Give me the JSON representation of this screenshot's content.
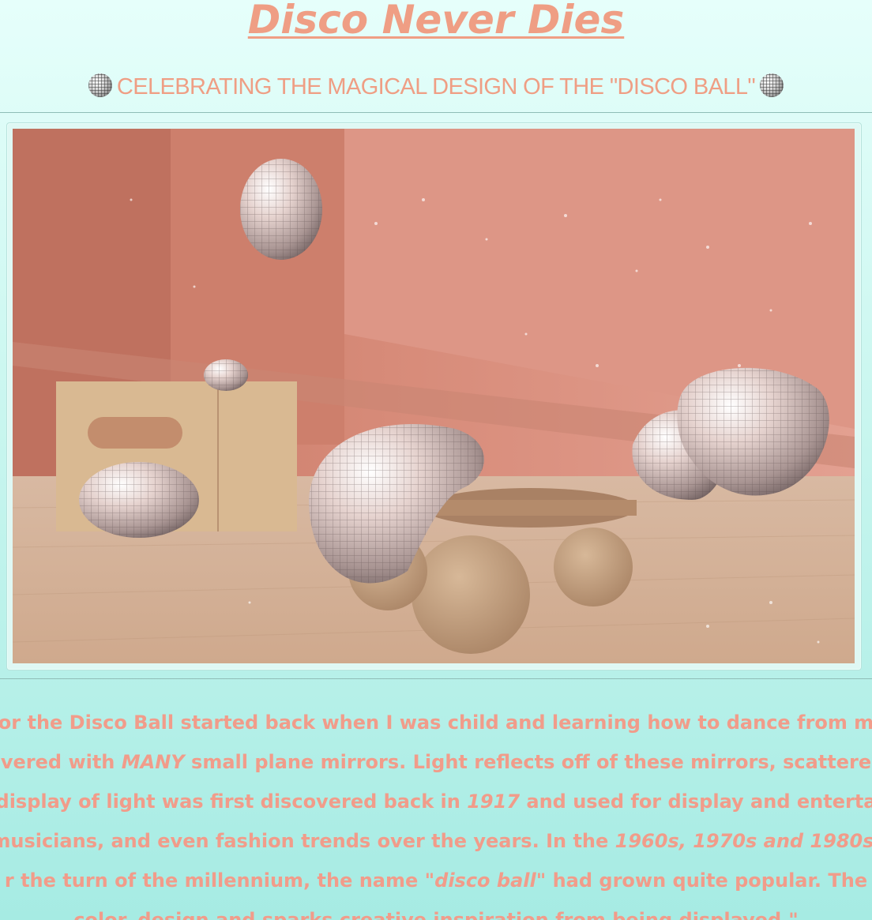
{
  "header": {
    "title": "Disco Never Dies",
    "subtitle": "CELEBRATING THE MAGICAL DESIGN OF THE \"DISCO BALL\"",
    "subtitle_icon": "disco-ball-icon"
  },
  "hero_image": {
    "alt": "Pink room with mirrored disco ball sculptures, a round table on spherical legs and a puzzle-shaped stone bench"
  },
  "intro": {
    "lines": [
      [
        {
          "t": "or the Disco Ball started back when I was child and learning how to dance from m"
        }
      ],
      [
        {
          "t": "vered with "
        },
        {
          "t": "MANY",
          "em": true
        },
        {
          "t": " small plane mirrors. Light reflects off of these mirrors, scattere"
        }
      ],
      [
        {
          "t": "display of light was first discovered back in "
        },
        {
          "t": "1917",
          "em": true
        },
        {
          "t": " and used for display and enterta"
        }
      ],
      [
        {
          "t": "musicians, and even fashion trends over the years. In the "
        },
        {
          "t": "1960s, 1970s and 1980s,",
          "em": true
        }
      ],
      [
        {
          "t": "r the turn of the millennium, the name "
        },
        {
          "t": "\"disco ball\"",
          "em": true
        },
        {
          "t": " had grown quite popular. The"
        }
      ],
      [
        {
          "t": "color, design and sparks creative inspiration from being displayed.\""
        }
      ]
    ]
  },
  "colors": {
    "accent": "#ef9e84",
    "background_top": "#e6fffb",
    "background_bottom": "#a6ebe3"
  }
}
